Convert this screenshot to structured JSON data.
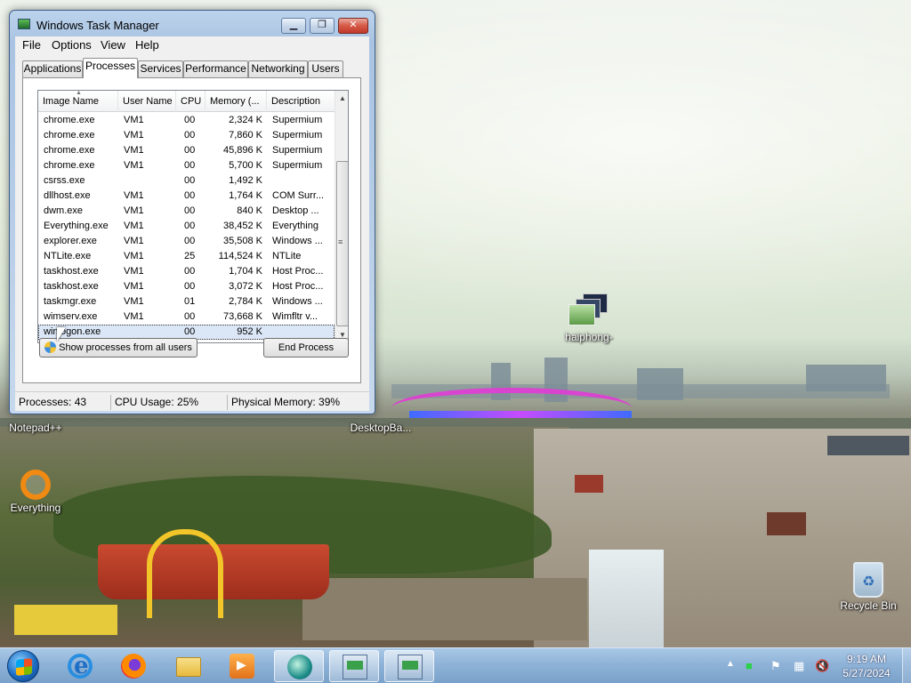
{
  "window": {
    "title": "Windows Task Manager",
    "controls": {
      "minimize": "▁",
      "maximize": "❐",
      "close": "✕"
    },
    "menu": [
      "File",
      "Options",
      "View",
      "Help"
    ],
    "tabs": [
      "Applications",
      "Processes",
      "Services",
      "Performance",
      "Networking",
      "Users"
    ],
    "active_tab": "Processes",
    "columns": [
      "Image Name",
      "User Name",
      "CPU",
      "Memory (...",
      "Description"
    ],
    "processes": [
      {
        "name": "chrome.exe",
        "user": "VM1",
        "cpu": "00",
        "memory": "2,324 K",
        "description": "Supermium"
      },
      {
        "name": "chrome.exe",
        "user": "VM1",
        "cpu": "00",
        "memory": "7,860 K",
        "description": "Supermium"
      },
      {
        "name": "chrome.exe",
        "user": "VM1",
        "cpu": "00",
        "memory": "45,896 K",
        "description": "Supermium"
      },
      {
        "name": "chrome.exe",
        "user": "VM1",
        "cpu": "00",
        "memory": "5,700 K",
        "description": "Supermium"
      },
      {
        "name": "csrss.exe",
        "user": "",
        "cpu": "00",
        "memory": "1,492 K",
        "description": ""
      },
      {
        "name": "dllhost.exe",
        "user": "VM1",
        "cpu": "00",
        "memory": "1,764 K",
        "description": "COM Surr..."
      },
      {
        "name": "dwm.exe",
        "user": "VM1",
        "cpu": "00",
        "memory": "840 K",
        "description": "Desktop ..."
      },
      {
        "name": "Everything.exe",
        "user": "VM1",
        "cpu": "00",
        "memory": "38,452 K",
        "description": "Everything"
      },
      {
        "name": "explorer.exe",
        "user": "VM1",
        "cpu": "00",
        "memory": "35,508 K",
        "description": "Windows ..."
      },
      {
        "name": "NTLite.exe",
        "user": "VM1",
        "cpu": "25",
        "memory": "114,524 K",
        "description": "NTLite"
      },
      {
        "name": "taskhost.exe",
        "user": "VM1",
        "cpu": "00",
        "memory": "1,704 K",
        "description": "Host Proc..."
      },
      {
        "name": "taskhost.exe",
        "user": "VM1",
        "cpu": "00",
        "memory": "3,072 K",
        "description": "Host Proc..."
      },
      {
        "name": "taskmgr.exe",
        "user": "VM1",
        "cpu": "01",
        "memory": "2,784 K",
        "description": "Windows ..."
      },
      {
        "name": "wimserv.exe",
        "user": "VM1",
        "cpu": "00",
        "memory": "73,668 K",
        "description": "Wimfltr v..."
      },
      {
        "name": "winlogon.exe",
        "user": "",
        "cpu": "00",
        "memory": "952 K",
        "description": ""
      }
    ],
    "selected_row": 14,
    "buttons": {
      "show_all": "Show processes from all users",
      "end_process": "End Process"
    },
    "status": {
      "processes": "Processes: 43",
      "cpu": "CPU Usage: 25%",
      "memory": "Physical Memory: 39%"
    }
  },
  "desktop_icons": [
    {
      "label": "Notepad++"
    },
    {
      "label": "DesktopBa..."
    },
    {
      "label": "Everything"
    },
    {
      "label": "haiphong-"
    },
    {
      "label": "Recycle Bin"
    }
  ],
  "taskbar": {
    "pinned": [
      "internet-explorer-icon",
      "firefox-icon",
      "file-explorer-icon",
      "media-player-icon",
      "disc-app-icon",
      "control-panel-icon",
      "task-manager-icon"
    ],
    "clock": {
      "time": "9:19 AM",
      "date": "5/27/2024"
    }
  },
  "colors": {
    "selection": "#dbe7f7",
    "taskbar": "#8fb3d8",
    "close_button": "#c0392b"
  }
}
